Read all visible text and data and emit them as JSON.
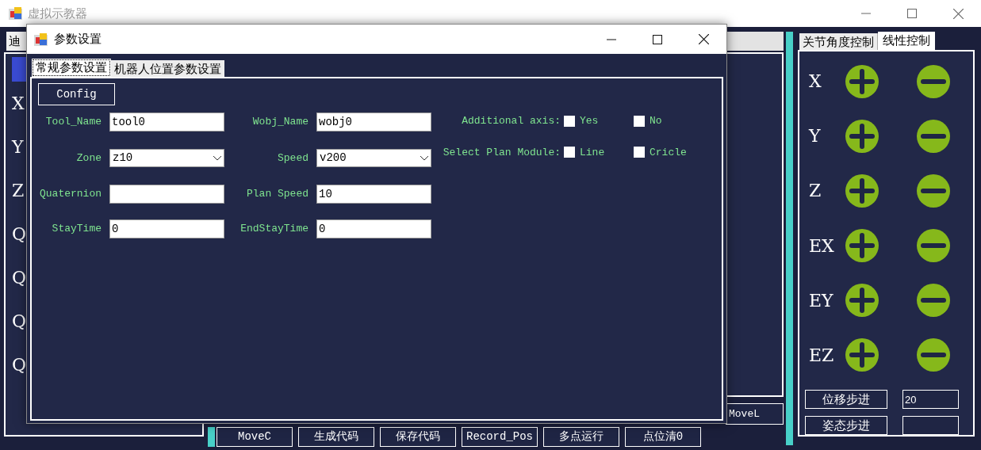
{
  "main_window": {
    "title": "虚拟示教器",
    "left_tab": "迪",
    "axis_labels": [
      "X",
      "Y",
      "Z",
      "Q",
      "Q",
      "Q",
      "Q"
    ],
    "movel_button": "MoveL",
    "bottom_buttons": [
      "MoveC",
      "生成代码",
      "保存代码",
      "Record_Pos",
      "多点运行",
      "点位清0"
    ],
    "right_tabs": [
      {
        "label": "关节角度控制",
        "selected": false
      },
      {
        "label": "线性控制",
        "selected": true
      }
    ],
    "jog_rows": [
      {
        "axis": "X"
      },
      {
        "axis": "Y"
      },
      {
        "axis": "Z"
      },
      {
        "axis": "EX"
      },
      {
        "axis": "EY"
      },
      {
        "axis": "EZ"
      }
    ],
    "step_controls": [
      {
        "label": "位移步进",
        "value": "20"
      },
      {
        "label": "姿态步进"
      }
    ]
  },
  "dialog": {
    "title": "参数设置",
    "tabs": [
      {
        "label": "常规参数设置",
        "selected": true
      },
      {
        "label": "机器人位置参数设置",
        "selected": false
      }
    ],
    "config_button": "Config",
    "fields": [
      {
        "label": "Tool_Name",
        "value": "tool0",
        "kind": "text"
      },
      {
        "label": "Wobj_Name",
        "value": "wobj0",
        "kind": "text"
      },
      {
        "label": "Zone",
        "value": "z10",
        "kind": "select"
      },
      {
        "label": "Speed",
        "value": "v200",
        "kind": "select"
      },
      {
        "label": "Quaternion",
        "kind": "text"
      },
      {
        "label": "Plan Speed",
        "value": "10",
        "kind": "text"
      },
      {
        "label": "StayTime",
        "value": "0",
        "kind": "text"
      },
      {
        "label": "EndStayTime",
        "value": "0",
        "kind": "text"
      }
    ],
    "options": [
      {
        "label": "Additional axis:",
        "choices": [
          {
            "label": "Yes",
            "checked": false
          },
          {
            "label": "No",
            "checked": false
          }
        ]
      },
      {
        "label": "Select Plan Module:",
        "choices": [
          {
            "label": "Line",
            "checked": false
          },
          {
            "label": "Cricle",
            "checked": false
          }
        ]
      }
    ]
  }
}
